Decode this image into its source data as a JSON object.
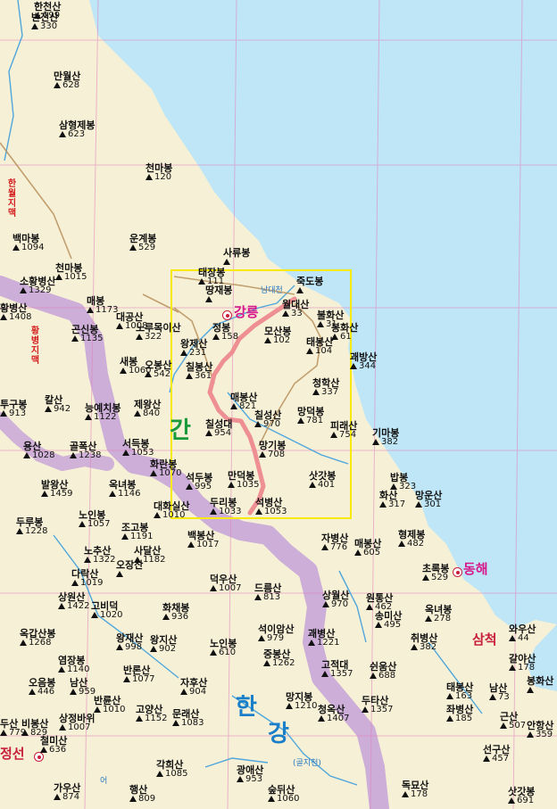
{
  "peaks": [
    {
      "name": "한천산",
      "elev": "199"
    },
    {
      "name": "반전산",
      "elev": "330"
    },
    {
      "name": "만월산",
      "elev": "628"
    },
    {
      "name": "삼형제봉",
      "elev": "623"
    },
    {
      "name": "천마봉",
      "elev": "120"
    },
    {
      "name": "백마봉",
      "elev": "1094"
    },
    {
      "name": "운계봉",
      "elev": "529"
    },
    {
      "name": "천마봉",
      "elev": "1015"
    },
    {
      "name": "사류봉",
      "elev": ""
    },
    {
      "name": "소황병산",
      "elev": "1329"
    },
    {
      "name": "태장봉",
      "elev": "111"
    },
    {
      "name": "땅재봉",
      "elev": ""
    },
    {
      "name": "죽도봉",
      "elev": ""
    },
    {
      "name": "월대산",
      "elev": "33"
    },
    {
      "name": "매봉",
      "elev": "1173"
    },
    {
      "name": "황병산",
      "elev": "1408"
    },
    {
      "name": "대공산",
      "elev": "1008"
    },
    {
      "name": "곤신봉",
      "elev": "1135"
    },
    {
      "name": "노루목이산",
      "elev": "322"
    },
    {
      "name": "정봉",
      "elev": "158"
    },
    {
      "name": "모산봉",
      "elev": "102"
    },
    {
      "name": "불화산",
      "elev": "31"
    },
    {
      "name": "봉화산",
      "elev": "61"
    },
    {
      "name": "태봉산",
      "elev": "104"
    },
    {
      "name": "괘방산",
      "elev": "344"
    },
    {
      "name": "왕제산",
      "elev": "231"
    },
    {
      "name": "새봉",
      "elev": "1060"
    },
    {
      "name": "오봉산",
      "elev": "542"
    },
    {
      "name": "칠봉산",
      "elev": "361"
    },
    {
      "name": "청학산",
      "elev": "337"
    },
    {
      "name": "칼산",
      "elev": "942"
    },
    {
      "name": "투구봉",
      "elev": "913"
    },
    {
      "name": "능예치봉",
      "elev": "1122"
    },
    {
      "name": "제왕산",
      "elev": "840"
    },
    {
      "name": "매봉산",
      "elev": "821"
    },
    {
      "name": "칠성산",
      "elev": "970"
    },
    {
      "name": "칠성대",
      "elev": "954"
    },
    {
      "name": "망덕봉",
      "elev": "781"
    },
    {
      "name": "피래산",
      "elev": "754"
    },
    {
      "name": "기마봉",
      "elev": "382"
    },
    {
      "name": "용산",
      "elev": "1028"
    },
    {
      "name": "골폭산",
      "elev": "1238"
    },
    {
      "name": "서득봉",
      "elev": "1053"
    },
    {
      "name": "망기봉",
      "elev": "708"
    },
    {
      "name": "발왕산",
      "elev": "1459"
    },
    {
      "name": "화란봉",
      "elev": "1070"
    },
    {
      "name": "옥녀봉",
      "elev": "1146"
    },
    {
      "name": "석두봉",
      "elev": "995"
    },
    {
      "name": "만덕봉",
      "elev": "1035"
    },
    {
      "name": "삿갓봉",
      "elev": "401"
    },
    {
      "name": "밥봉",
      "elev": "323"
    },
    {
      "name": "화산",
      "elev": "317"
    },
    {
      "name": "망운산",
      "elev": "301"
    },
    {
      "name": "대화실산",
      "elev": "1010"
    },
    {
      "name": "두리봉",
      "elev": "1033"
    },
    {
      "name": "석병산",
      "elev": "1053"
    },
    {
      "name": "노인봉",
      "elev": "1057"
    },
    {
      "name": "두루봉",
      "elev": "1228"
    },
    {
      "name": "조고봉",
      "elev": "1191"
    },
    {
      "name": "백봉산",
      "elev": "1017"
    },
    {
      "name": "자병산",
      "elev": "776"
    },
    {
      "name": "매봉산",
      "elev": "605"
    },
    {
      "name": "형제봉",
      "elev": "482"
    },
    {
      "name": "초록봉",
      "elev": "529"
    },
    {
      "name": "노추산",
      "elev": "1322"
    },
    {
      "name": "사달산",
      "elev": "1182"
    },
    {
      "name": "다락산",
      "elev": "1019"
    },
    {
      "name": "오장산",
      "elev": ""
    },
    {
      "name": "덕우산",
      "elev": "1007"
    },
    {
      "name": "드름산",
      "elev": "813"
    },
    {
      "name": "상원산",
      "elev": "1422"
    },
    {
      "name": "고비덕",
      "elev": "1020"
    },
    {
      "name": "화채봉",
      "elev": "936"
    },
    {
      "name": "상월산",
      "elev": "970"
    },
    {
      "name": "원통산",
      "elev": "462"
    },
    {
      "name": "송미산",
      "elev": "495"
    },
    {
      "name": "옥녀봉",
      "elev": "278"
    },
    {
      "name": "옥갑산봉",
      "elev": "1268"
    },
    {
      "name": "왕재산",
      "elev": "998"
    },
    {
      "name": "왕지산",
      "elev": "902"
    },
    {
      "name": "석이암산",
      "elev": "979"
    },
    {
      "name": "괘병산",
      "elev": "1221"
    },
    {
      "name": "취병산",
      "elev": "382"
    },
    {
      "name": "와우산",
      "elev": "44"
    },
    {
      "name": "염장봉",
      "elev": "1140"
    },
    {
      "name": "반론산",
      "elev": "1077"
    },
    {
      "name": "노인봉",
      "elev": "610"
    },
    {
      "name": "중봉산",
      "elev": "1262"
    },
    {
      "name": "고적대",
      "elev": "1357"
    },
    {
      "name": "쉰움산",
      "elev": "688"
    },
    {
      "name": "갈야산",
      "elev": "178"
    },
    {
      "name": "오음봉",
      "elev": "446"
    },
    {
      "name": "남산",
      "elev": "959"
    },
    {
      "name": "반륜산",
      "elev": "1010"
    },
    {
      "name": "자후산",
      "elev": "904"
    },
    {
      "name": "망지봉",
      "elev": "1210"
    },
    {
      "name": "태봉산",
      "elev": "163"
    },
    {
      "name": "남산",
      "elev": "73"
    },
    {
      "name": "봉화산",
      "elev": ""
    },
    {
      "name": "두산",
      "elev": "779"
    },
    {
      "name": "비봉산",
      "elev": "829"
    },
    {
      "name": "상정바위",
      "elev": "1007"
    },
    {
      "name": "고양산",
      "elev": "1152"
    },
    {
      "name": "문래산",
      "elev": "1083"
    },
    {
      "name": "청옥산",
      "elev": "1407"
    },
    {
      "name": "두타산",
      "elev": "1357"
    },
    {
      "name": "좌병산",
      "elev": "185"
    },
    {
      "name": "근산",
      "elev": "507"
    },
    {
      "name": "안항산",
      "elev": "359"
    },
    {
      "name": "철미산",
      "elev": "636"
    },
    {
      "name": "선구산",
      "elev": "457"
    },
    {
      "name": "각희산",
      "elev": "1085"
    },
    {
      "name": "광애산",
      "elev": "953"
    },
    {
      "name": "가우산",
      "elev": "874"
    },
    {
      "name": "행산",
      "elev": "809"
    },
    {
      "name": "숲뒤산",
      "elev": "1060"
    },
    {
      "name": "독묘산",
      "elev": "178"
    },
    {
      "name": "삿갓봉",
      "elev": "691"
    }
  ],
  "cities": {
    "gangneung": "강릉",
    "donghae": "동해",
    "samcheok": "삼척",
    "jeongseon": "정선"
  },
  "big_labels": {
    "gan": "간",
    "han": "한",
    "gang": "강"
  },
  "ranges": {
    "hanwol": "한월지맥",
    "hwangbyeong": "황병지맥"
  },
  "rivers": {
    "namdaecheon": "남대천",
    "golji": "(골지천)",
    "eo": "어"
  },
  "colors": {
    "sea": "#bfe6f6",
    "land": "#f6f1d6",
    "ridge": "#c9a6d8",
    "route": "#ee8f94",
    "highlight": "#f7ea00",
    "grid": "#e07fbe",
    "river": "#4fa6dc"
  }
}
